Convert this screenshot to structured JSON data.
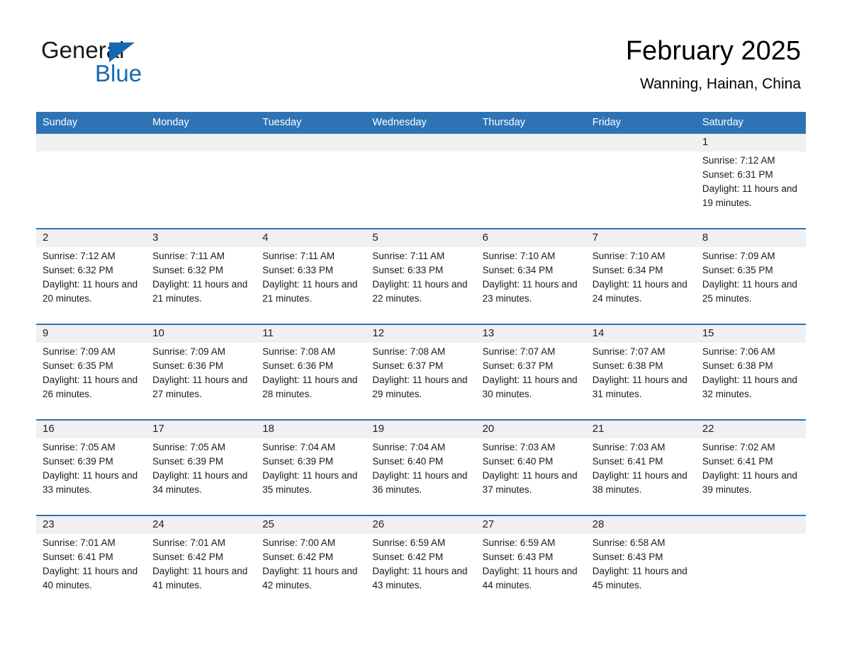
{
  "brand": {
    "line1": "General",
    "line2": "Blue",
    "triangle_icon": "blue-triangle-logo-mark",
    "accent_color": "#1569b0"
  },
  "header": {
    "title": "February 2025",
    "subtitle": "Wanning, Hainan, China",
    "header_bg_color": "#2e74b5",
    "row_border_color": "#2e74b5",
    "daynum_bg_color": "#f0f0f0"
  },
  "weekdays": [
    "Sunday",
    "Monday",
    "Tuesday",
    "Wednesday",
    "Thursday",
    "Friday",
    "Saturday"
  ],
  "labels": {
    "sunrise_prefix": "Sunrise:",
    "sunset_prefix": "Sunset:",
    "daylight_prefix": "Daylight:"
  },
  "weeks": [
    [
      {
        "blank": true
      },
      {
        "blank": true
      },
      {
        "blank": true
      },
      {
        "blank": true
      },
      {
        "blank": true
      },
      {
        "blank": true
      },
      {
        "day": "1",
        "sunrise": "Sunrise: 7:12 AM",
        "sunset": "Sunset: 6:31 PM",
        "daylight": "Daylight: 11 hours and 19 minutes."
      }
    ],
    [
      {
        "day": "2",
        "sunrise": "Sunrise: 7:12 AM",
        "sunset": "Sunset: 6:32 PM",
        "daylight": "Daylight: 11 hours and 20 minutes."
      },
      {
        "day": "3",
        "sunrise": "Sunrise: 7:11 AM",
        "sunset": "Sunset: 6:32 PM",
        "daylight": "Daylight: 11 hours and 21 minutes."
      },
      {
        "day": "4",
        "sunrise": "Sunrise: 7:11 AM",
        "sunset": "Sunset: 6:33 PM",
        "daylight": "Daylight: 11 hours and 21 minutes."
      },
      {
        "day": "5",
        "sunrise": "Sunrise: 7:11 AM",
        "sunset": "Sunset: 6:33 PM",
        "daylight": "Daylight: 11 hours and 22 minutes."
      },
      {
        "day": "6",
        "sunrise": "Sunrise: 7:10 AM",
        "sunset": "Sunset: 6:34 PM",
        "daylight": "Daylight: 11 hours and 23 minutes."
      },
      {
        "day": "7",
        "sunrise": "Sunrise: 7:10 AM",
        "sunset": "Sunset: 6:34 PM",
        "daylight": "Daylight: 11 hours and 24 minutes."
      },
      {
        "day": "8",
        "sunrise": "Sunrise: 7:09 AM",
        "sunset": "Sunset: 6:35 PM",
        "daylight": "Daylight: 11 hours and 25 minutes."
      }
    ],
    [
      {
        "day": "9",
        "sunrise": "Sunrise: 7:09 AM",
        "sunset": "Sunset: 6:35 PM",
        "daylight": "Daylight: 11 hours and 26 minutes."
      },
      {
        "day": "10",
        "sunrise": "Sunrise: 7:09 AM",
        "sunset": "Sunset: 6:36 PM",
        "daylight": "Daylight: 11 hours and 27 minutes."
      },
      {
        "day": "11",
        "sunrise": "Sunrise: 7:08 AM",
        "sunset": "Sunset: 6:36 PM",
        "daylight": "Daylight: 11 hours and 28 minutes."
      },
      {
        "day": "12",
        "sunrise": "Sunrise: 7:08 AM",
        "sunset": "Sunset: 6:37 PM",
        "daylight": "Daylight: 11 hours and 29 minutes."
      },
      {
        "day": "13",
        "sunrise": "Sunrise: 7:07 AM",
        "sunset": "Sunset: 6:37 PM",
        "daylight": "Daylight: 11 hours and 30 minutes."
      },
      {
        "day": "14",
        "sunrise": "Sunrise: 7:07 AM",
        "sunset": "Sunset: 6:38 PM",
        "daylight": "Daylight: 11 hours and 31 minutes."
      },
      {
        "day": "15",
        "sunrise": "Sunrise: 7:06 AM",
        "sunset": "Sunset: 6:38 PM",
        "daylight": "Daylight: 11 hours and 32 minutes."
      }
    ],
    [
      {
        "day": "16",
        "sunrise": "Sunrise: 7:05 AM",
        "sunset": "Sunset: 6:39 PM",
        "daylight": "Daylight: 11 hours and 33 minutes."
      },
      {
        "day": "17",
        "sunrise": "Sunrise: 7:05 AM",
        "sunset": "Sunset: 6:39 PM",
        "daylight": "Daylight: 11 hours and 34 minutes."
      },
      {
        "day": "18",
        "sunrise": "Sunrise: 7:04 AM",
        "sunset": "Sunset: 6:39 PM",
        "daylight": "Daylight: 11 hours and 35 minutes."
      },
      {
        "day": "19",
        "sunrise": "Sunrise: 7:04 AM",
        "sunset": "Sunset: 6:40 PM",
        "daylight": "Daylight: 11 hours and 36 minutes."
      },
      {
        "day": "20",
        "sunrise": "Sunrise: 7:03 AM",
        "sunset": "Sunset: 6:40 PM",
        "daylight": "Daylight: 11 hours and 37 minutes."
      },
      {
        "day": "21",
        "sunrise": "Sunrise: 7:03 AM",
        "sunset": "Sunset: 6:41 PM",
        "daylight": "Daylight: 11 hours and 38 minutes."
      },
      {
        "day": "22",
        "sunrise": "Sunrise: 7:02 AM",
        "sunset": "Sunset: 6:41 PM",
        "daylight": "Daylight: 11 hours and 39 minutes."
      }
    ],
    [
      {
        "day": "23",
        "sunrise": "Sunrise: 7:01 AM",
        "sunset": "Sunset: 6:41 PM",
        "daylight": "Daylight: 11 hours and 40 minutes."
      },
      {
        "day": "24",
        "sunrise": "Sunrise: 7:01 AM",
        "sunset": "Sunset: 6:42 PM",
        "daylight": "Daylight: 11 hours and 41 minutes."
      },
      {
        "day": "25",
        "sunrise": "Sunrise: 7:00 AM",
        "sunset": "Sunset: 6:42 PM",
        "daylight": "Daylight: 11 hours and 42 minutes."
      },
      {
        "day": "26",
        "sunrise": "Sunrise: 6:59 AM",
        "sunset": "Sunset: 6:42 PM",
        "daylight": "Daylight: 11 hours and 43 minutes."
      },
      {
        "day": "27",
        "sunrise": "Sunrise: 6:59 AM",
        "sunset": "Sunset: 6:43 PM",
        "daylight": "Daylight: 11 hours and 44 minutes."
      },
      {
        "day": "28",
        "sunrise": "Sunrise: 6:58 AM",
        "sunset": "Sunset: 6:43 PM",
        "daylight": "Daylight: 11 hours and 45 minutes."
      },
      {
        "blank": true
      }
    ]
  ]
}
